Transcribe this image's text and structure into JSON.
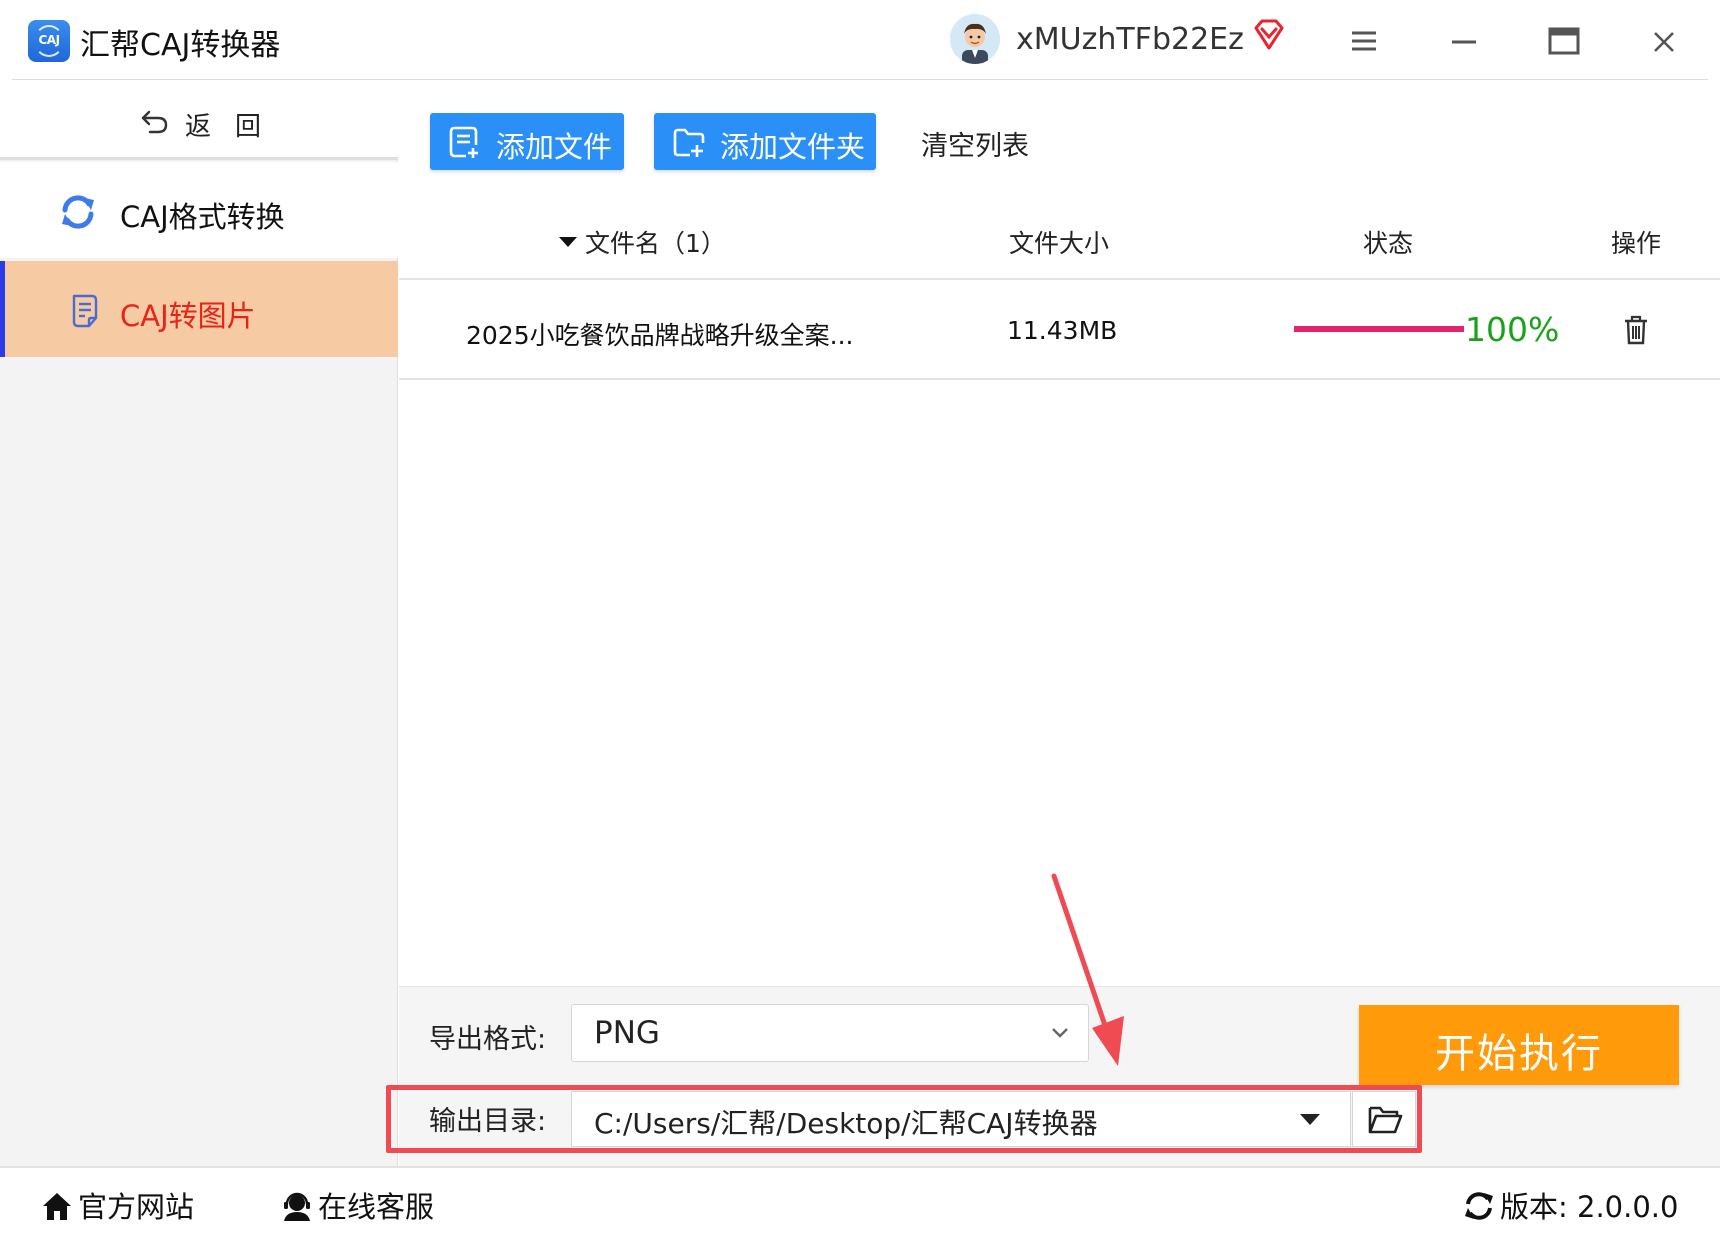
{
  "app": {
    "title": "汇帮CAJ转换器",
    "logo_text": "CAJ",
    "username": "xMUzhTFb22Ez"
  },
  "window_controls": [
    "menu-icon",
    "minimize-icon",
    "maximize-icon",
    "close-icon"
  ],
  "sidebar": {
    "back_label": "返回",
    "items": [
      {
        "label": "CAJ格式转换",
        "icon": "refresh-icon",
        "active": false
      },
      {
        "label": "CAJ转图片",
        "icon": "document-icon",
        "active": true
      }
    ]
  },
  "toolbar": {
    "add_file": "添加文件",
    "add_folder": "添加文件夹",
    "clear_list": "清空列表"
  },
  "table": {
    "headers": {
      "name": "文件名（1）",
      "size": "文件大小",
      "status": "状态",
      "operation": "操作"
    },
    "rows": [
      {
        "name": "2025小吃餐饮品牌战略升级全案...",
        "size": "11.43MB",
        "status": "100%",
        "progress": 1.0
      }
    ]
  },
  "export": {
    "format_label": "导出格式:",
    "format_value": "PNG",
    "output_label": "输出目录:",
    "output_value": "C:/Users/汇帮/Desktop/汇帮CAJ转换器",
    "start_label": "开始执行"
  },
  "footer": {
    "website": "官方网站",
    "service": "在线客服",
    "version": "版本: 2.0.0.0"
  },
  "colors": {
    "accent_blue": "#2a8ff7",
    "active_nav_bg": "#f6caa2",
    "active_nav_text": "#e7231a",
    "start_button": "#ff9a0a",
    "progress_bar": "#e3246b",
    "status_text": "#1aa31a",
    "highlight_box": "#f04a52"
  }
}
